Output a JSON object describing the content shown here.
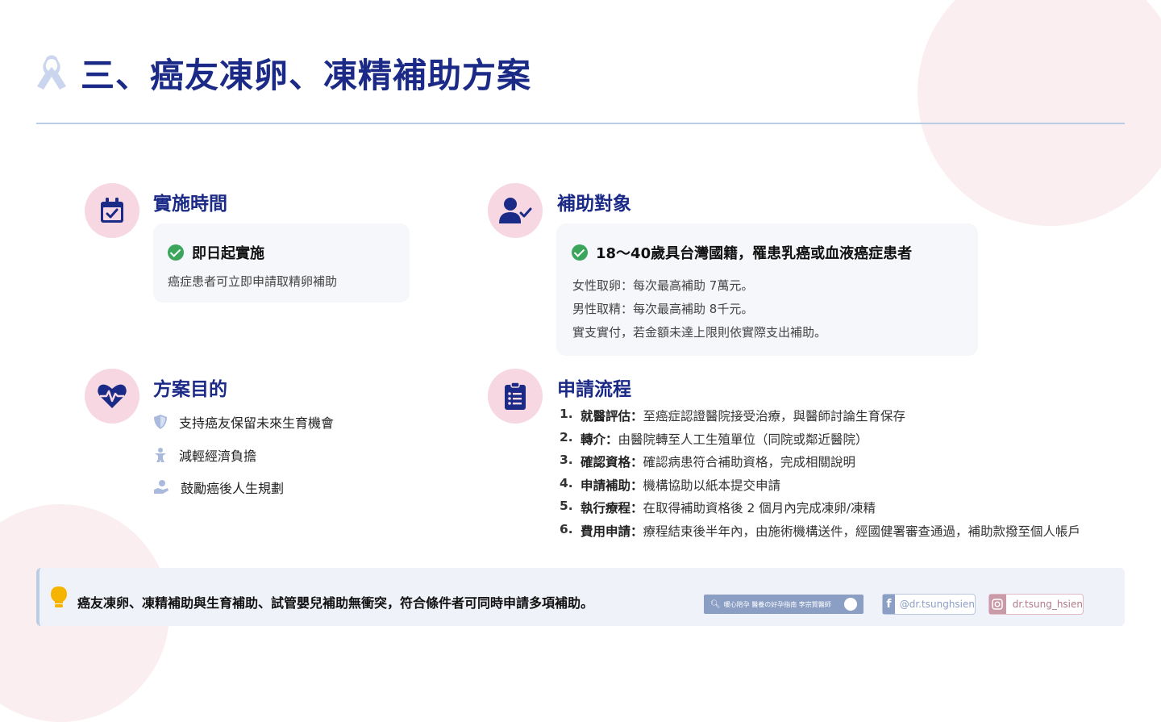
{
  "title": "三、癌友凍卵、凍精補助方案",
  "sections": {
    "time": {
      "title": "實施時間",
      "headline": "即日起實施",
      "desc": "癌症患者可立即申請取精卵補助"
    },
    "target": {
      "title": "補助對象",
      "headline": "18～40歲具台灣國籍，罹患乳癌或血液癌症患者",
      "lines": [
        "女性取卵：每次最高補助 7萬元。",
        "男性取精：每次最高補助 8千元。",
        "實支實付，若金額未達上限則依實際支出補助。"
      ]
    },
    "goal": {
      "title": "方案目的",
      "items": [
        "支持癌友保留未來生育機會",
        "減輕經濟負擔",
        "鼓勵癌後人生規劃"
      ]
    },
    "process": {
      "title": "申請流程",
      "steps": [
        {
          "num": "1.",
          "key": "就醫評估：",
          "text": "至癌症認證醫院接受治療，與醫師討論生育保存"
        },
        {
          "num": "2.",
          "key": "轉介：",
          "text": "由醫院轉至人工生殖單位（同院或鄰近醫院）"
        },
        {
          "num": "3.",
          "key": "確認資格：",
          "text": "確認病患符合補助資格，完成相關說明"
        },
        {
          "num": "4.",
          "key": "申請補助：",
          "text": "機構協助以紙本提交申請"
        },
        {
          "num": "5.",
          "key": "執行療程：",
          "text": "在取得補助資格後 2 個月內完成凍卵/凍精"
        },
        {
          "num": "6.",
          "key": "費用申請：",
          "text": "療程結束後半年內，由施術機構送件，經國健署審查通過，補助款撥至個人帳戶"
        }
      ]
    }
  },
  "footer": {
    "note": "癌友凍卵、凍精補助與生育補助、試管嬰兒補助無衝突，符合條件者可同時申請多項補助。",
    "search_text": "暖心陪孕 醫養の好孕指南 李宗賢醫師",
    "facebook": "@dr.tsunghsien",
    "instagram": "dr.tsung_hsien"
  },
  "colors": {
    "accent": "#1b2a86",
    "pink": "#f6d7e2",
    "check": "#3aa55b",
    "rule": "#b9cde6"
  },
  "icons": [
    "ribbon-icon",
    "calendar-check-icon",
    "user-check-icon",
    "heart-pulse-icon",
    "clipboard-list-icon",
    "check-circle-icon",
    "shield-icon",
    "child-icon",
    "hand-coin-icon",
    "lightbulb-icon",
    "search-icon",
    "messenger-icon",
    "facebook-icon",
    "instagram-icon"
  ]
}
